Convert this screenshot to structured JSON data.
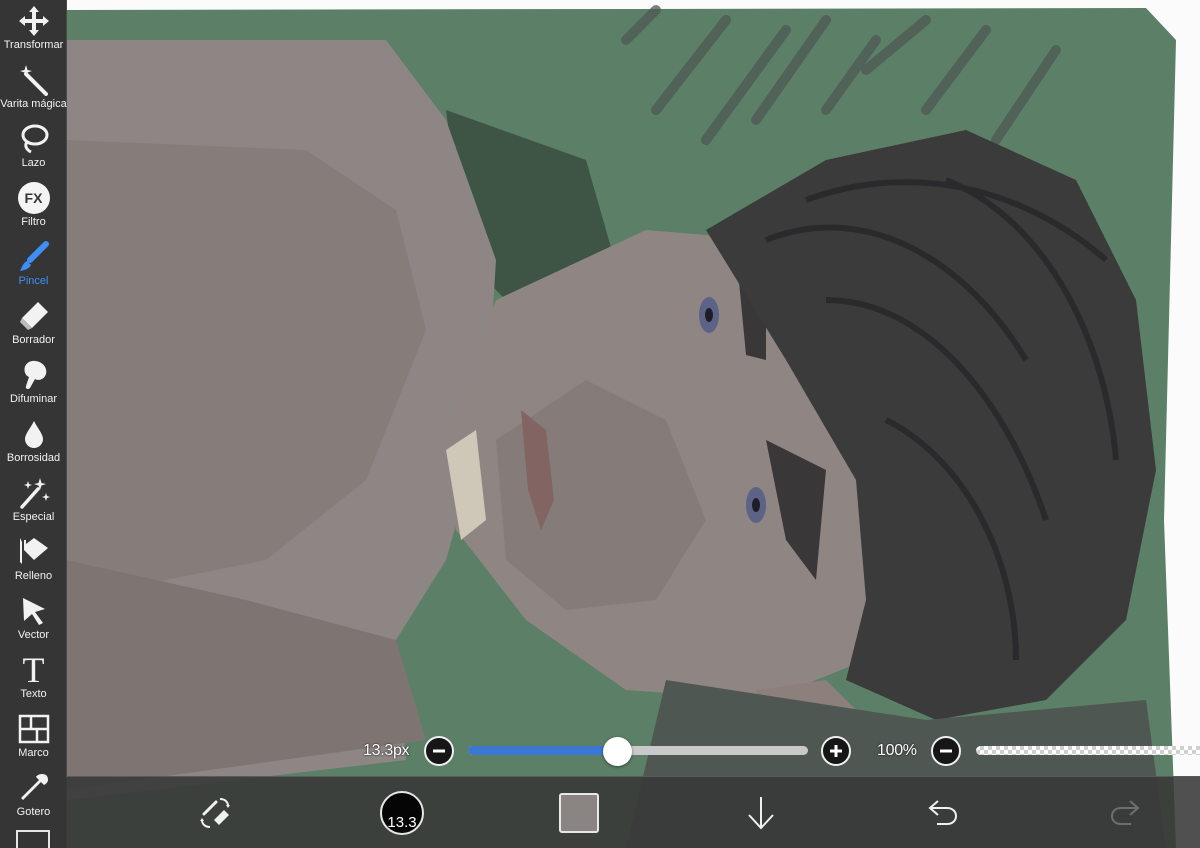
{
  "toolbar": {
    "items": [
      {
        "label": "Transformar",
        "icon": "move-arrows-icon",
        "active": false
      },
      {
        "label": "Varita mágica",
        "icon": "magic-wand-icon",
        "active": false
      },
      {
        "label": "Lazo",
        "icon": "lasso-icon",
        "active": false
      },
      {
        "label": "Filtro",
        "icon": "fx-filter-icon",
        "active": false
      },
      {
        "label": "Pincel",
        "icon": "brush-icon",
        "active": true
      },
      {
        "label": "Borrador",
        "icon": "eraser-icon",
        "active": false
      },
      {
        "label": "Difuminar",
        "icon": "smudge-icon",
        "active": false
      },
      {
        "label": "Borrosidad",
        "icon": "blur-drop-icon",
        "active": false
      },
      {
        "label": "Especial",
        "icon": "sparkle-icon",
        "active": false
      },
      {
        "label": "Relleno",
        "icon": "fill-bucket-icon",
        "active": false
      },
      {
        "label": "Vector",
        "icon": "vector-cursor-icon",
        "active": false
      },
      {
        "label": "Texto",
        "icon": "text-icon",
        "active": false
      },
      {
        "label": "Marco",
        "icon": "frame-icon",
        "active": false
      },
      {
        "label": "Gotero",
        "icon": "eyedropper-icon",
        "active": false
      }
    ],
    "fx_text": "FX",
    "text_icon_glyph": "T",
    "active_color": "#3d8ef5"
  },
  "brush_settings": {
    "size_label": "13.3px",
    "size_fraction": 0.44,
    "opacity_label": "100%",
    "opacity_fraction": 1.0,
    "accent_color": "#3b78d4"
  },
  "bottom_bar": {
    "brush_size_value": "13.3",
    "current_color": "#8a8483",
    "buttons": [
      "swap-tools-icon",
      "brush-size-preview",
      "color-swatch",
      "layer-down-arrow-icon",
      "undo-icon",
      "redo-icon"
    ]
  }
}
